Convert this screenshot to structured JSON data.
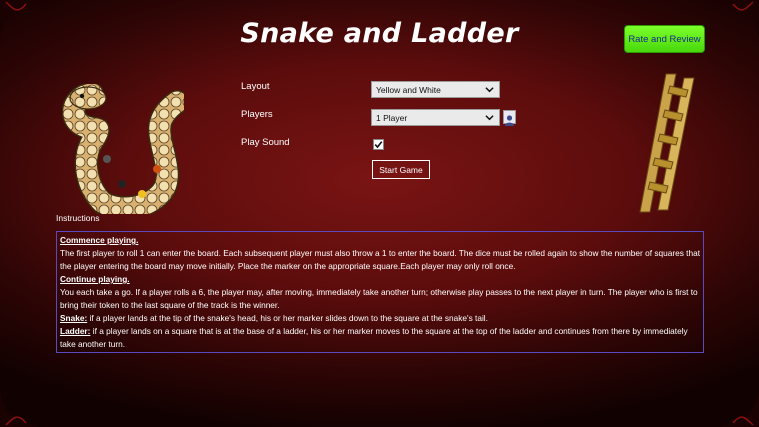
{
  "app": {
    "title": "Snake and Ladder",
    "rate_button": "Rate and Review"
  },
  "settings": {
    "layout_label": "Layout",
    "layout_value": "Yellow and White",
    "players_label": "Players",
    "players_value": "1 Player",
    "sound_label": "Play Sound",
    "sound_checked": true,
    "start_button": "Start Game"
  },
  "instructions": {
    "heading": "Instructions",
    "commence_title": "Commence playing.",
    "commence_text": "The first player to roll 1 can enter the board. Each subsequent player must also throw a 1 to enter the board. The dice must be rolled again to show the number of squares that the player entering the board may move initially. Place the marker on the appropriate square.Each player may only roll once.",
    "continue_title": "Continue playing.",
    "continue_text": "You each take a go. If a player rolls a 6, the player may, after moving, immediately take another turn; otherwise play passes to the next player in turn. The player who is first to bring their token to the last square of the track is the winner.",
    "snake_title": "Snake:",
    "snake_text": " if a player lands at the tip of the snake's head, his or her marker slides down to the square at the snake's tail.",
    "ladder_title": "Ladder:",
    "ladder_text": " if a player lands on a square that is at the base of a ladder, his or her marker moves to the square at the top of the ladder and continues from there by immediately take another turn."
  },
  "icons": [
    "snake-image",
    "ladder-image",
    "chevron-down-icon",
    "avatar-icon",
    "checkmark-icon"
  ],
  "colors": {
    "background": "#5c0c0c",
    "rate_button": "#5ee81a",
    "instructions_border": "#5b49c0"
  }
}
